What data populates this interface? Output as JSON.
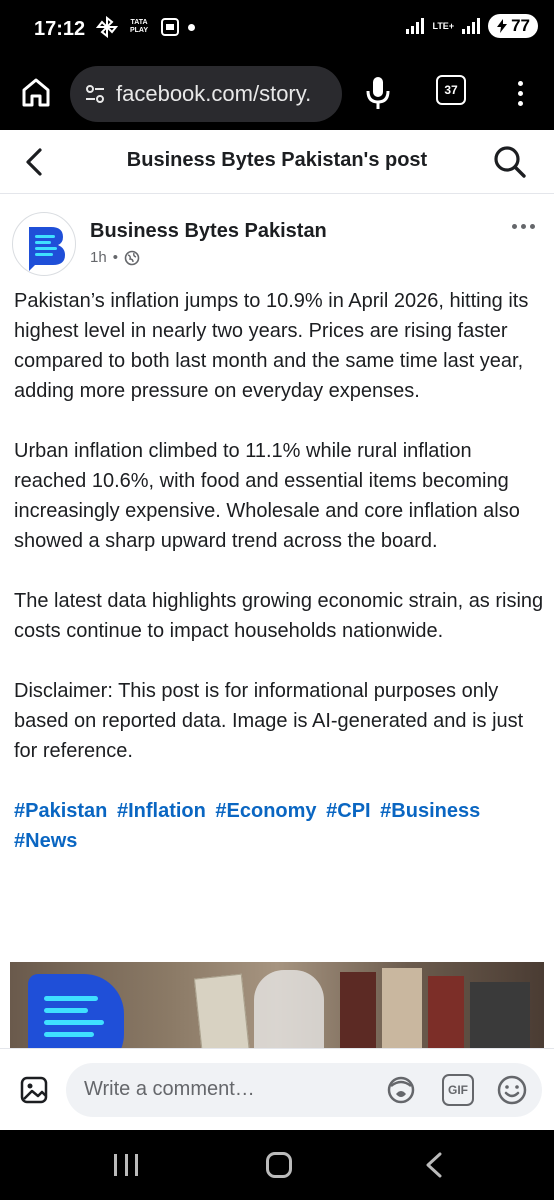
{
  "status_bar": {
    "time": "17:12",
    "carrier_badge": "TATA PLAY",
    "network": "LTE+",
    "battery": "77"
  },
  "browser": {
    "url": "facebook.com/story.",
    "tab_count": "37"
  },
  "header": {
    "title": "Business Bytes Pakistan's post"
  },
  "post": {
    "author": "Business Bytes Pakistan",
    "time": "1h",
    "privacy_icon": "globe-icon",
    "paragraphs": [
      "Pakistan’s inflation jumps to 10.9% in April 2026, hitting its highest level in nearly two years. Prices are rising faster compared to both last month and the same time last year, adding more pressure on everyday expenses.",
      "Urban inflation climbed to 11.1% while rural inflation reached 10.6%, with food and essential items becoming increasingly expensive. Wholesale and core inflation also showed a sharp upward trend across the board.",
      "The latest data highlights growing economic strain, as rising costs continue to impact households nationwide.",
      "Disclaimer: This post is for informational purposes only based on reported data. Image is AI-generated and is just for reference."
    ],
    "hashtags": [
      "#Pakistan",
      "#Inflation",
      "#Economy",
      "#CPI",
      "#Business",
      "#News"
    ]
  },
  "comment_bar": {
    "placeholder": "Write a comment…",
    "gif_label": "GIF"
  },
  "colors": {
    "hashtag": "#0a66c2",
    "brand_blue": "#1f4fd8",
    "accent_cyan": "#3fe0ff"
  }
}
